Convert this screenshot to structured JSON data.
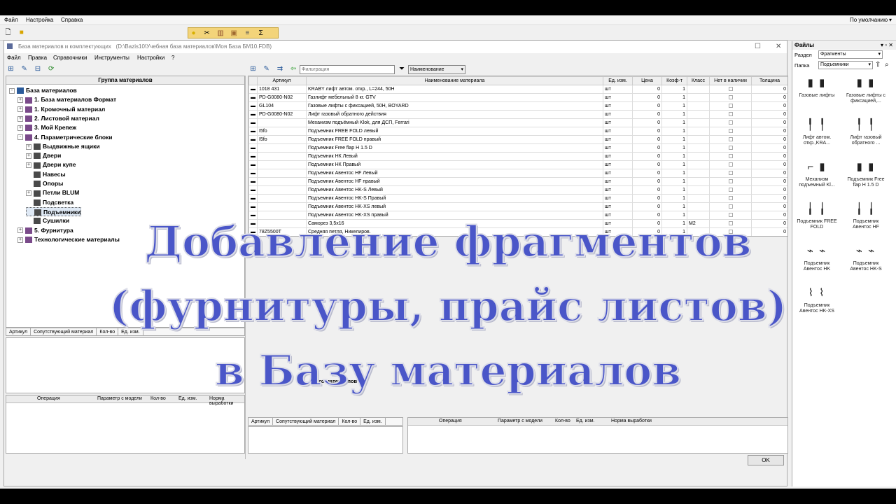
{
  "main_menu": [
    "Файл",
    "Настройка",
    "Справка"
  ],
  "profile": "По умолчанию",
  "child_window": {
    "title": "База материалов и комплектующих",
    "path": "(D:\\Bazis10\\Учебная база материалов\\Моя База БМ10.FDB)",
    "menu": [
      "Файл",
      "Правка",
      "Справочники",
      "Инструменты",
      "Настройки",
      "?"
    ]
  },
  "tree": {
    "header": "Группа материалов",
    "nodes": [
      {
        "label": "База материалов",
        "level": 0,
        "exp": "-"
      },
      {
        "label": "1. База материалов Формат",
        "level": 1,
        "exp": "+"
      },
      {
        "label": "1. Кромочный материал",
        "level": 1,
        "exp": "+"
      },
      {
        "label": "2. Листовой материал",
        "level": 1,
        "exp": "+"
      },
      {
        "label": "3. Мой Крепеж",
        "level": 1,
        "exp": "+"
      },
      {
        "label": "4. Параметрические блоки",
        "level": 1,
        "exp": "-"
      },
      {
        "label": "Выдвижные ящики",
        "level": 2,
        "exp": "+"
      },
      {
        "label": "Двери",
        "level": 2,
        "exp": "+"
      },
      {
        "label": "Двери купе",
        "level": 2,
        "exp": "+"
      },
      {
        "label": "Навесы",
        "level": 2,
        "exp": ""
      },
      {
        "label": "Опоры",
        "level": 2,
        "exp": ""
      },
      {
        "label": "Петли BLUM",
        "level": 2,
        "exp": "+"
      },
      {
        "label": "Подсветка",
        "level": 2,
        "exp": ""
      },
      {
        "label": "Подъемники",
        "level": 2,
        "exp": "",
        "selected": true
      },
      {
        "label": "Сушилки",
        "level": 2,
        "exp": ""
      },
      {
        "label": "5. Фурнитура",
        "level": 1,
        "exp": "+"
      },
      {
        "label": "Технологические материалы",
        "level": 1,
        "exp": "+"
      }
    ]
  },
  "filter_placeholder": "Фильтрация",
  "sort_field": "Наименование",
  "grid": {
    "columns": [
      "Артикул",
      "Наименование материала",
      "Ед. изм.",
      "Цена",
      "Коэф-т",
      "Класс",
      "Нет в наличии",
      "Толщина"
    ],
    "rows": [
      [
        "1018 431",
        "KRABY лифт автом. откр., L=244, 50H",
        "шт",
        "0",
        "1",
        "",
        "",
        "0"
      ],
      [
        "PD-G0080-N02",
        "Газлифт мебельный 8 кг. GTV",
        "шт",
        "0",
        "1",
        "",
        "",
        "0"
      ],
      [
        "GL104",
        "Газовые лифты с фиксацией, 50H, BOYARD",
        "шт",
        "0",
        "1",
        "",
        "",
        "0"
      ],
      [
        "PD-G0080-N02",
        "Лифт газовый обратного действия",
        "шт",
        "0",
        "1",
        "",
        "",
        "0"
      ],
      [
        "",
        "Механизм подъёмный Klok, для ДСП, Ferrari",
        "шт",
        "0",
        "1",
        "",
        "",
        "0"
      ],
      [
        "I5fo",
        "Подъемник FREE FOLD левый",
        "шт",
        "0",
        "1",
        "",
        "",
        "0"
      ],
      [
        "I5fo",
        "Подъемник FREE FOLD правый",
        "шт",
        "0",
        "1",
        "",
        "",
        "0"
      ],
      [
        "",
        "Подъемник Free flap H 1.5 D",
        "шт",
        "0",
        "1",
        "",
        "",
        "0"
      ],
      [
        "",
        "Подъемник НК Левый",
        "шт",
        "0",
        "1",
        "",
        "",
        "0"
      ],
      [
        "",
        "Подъемник НК Правый",
        "шт",
        "0",
        "1",
        "",
        "",
        "0"
      ],
      [
        "",
        "Подъемник Авентос HF Левый",
        "шт",
        "0",
        "1",
        "",
        "",
        "0"
      ],
      [
        "",
        "Подъемник Авентос HF правый",
        "шт",
        "0",
        "1",
        "",
        "",
        "0"
      ],
      [
        "",
        "Подъемник Авентос HK-S Левый",
        "шт",
        "0",
        "1",
        "",
        "",
        "0"
      ],
      [
        "",
        "Подъемник Авентос HK-S Правый",
        "шт",
        "0",
        "1",
        "",
        "",
        "0"
      ],
      [
        "",
        "Подъемник Авентос HK-XS левый",
        "шт",
        "0",
        "1",
        "",
        "",
        "0"
      ],
      [
        "",
        "Подъемник Авентос HK-XS правый",
        "шт",
        "0",
        "1",
        "",
        "",
        "0"
      ],
      [
        "",
        "Саморез 3,5х16",
        "шт",
        "0",
        "1",
        "M2",
        "",
        "0"
      ],
      [
        "78Z5500T",
        "Средняя петля, Никелиров.",
        "шт",
        "0",
        "1",
        "",
        "",
        "0"
      ]
    ]
  },
  "status": "Всего материалов : 18",
  "left_bottom_tabs": [
    "Артикул",
    "Сопутствующий материал",
    "Кол-во",
    "Ед. изм."
  ],
  "left_ops_headers": [
    "Операция",
    "Параметр с модели",
    "Кол-во",
    "Ед. изм.",
    "Норма выработки"
  ],
  "right_bottom_tabs": [
    "Артикул",
    "Сопутствующий материал",
    "Кол-во",
    "Ед. изм."
  ],
  "right_ops_headers": [
    "Операция",
    "Параметр с модели",
    "Кол-во",
    "Ед. изм.",
    "Норма выработки"
  ],
  "ok_label": "OK",
  "files_panel": {
    "title": "Файлы",
    "section_label": "Раздел",
    "section_value": "Фрагменты",
    "folder_label": "Папка",
    "folder_value": "Подъемники",
    "tiles": [
      {
        "caption": "Газовые лифты"
      },
      {
        "caption": "Газовые лифты с фиксацией,..."
      },
      {
        "caption": "Лифт автом. откр.,KRA..."
      },
      {
        "caption": "Лифт газовый обратного ..."
      },
      {
        "caption": "Механизм подъемный Kl..."
      },
      {
        "caption": "Подъемник Free flap H 1.5 D"
      },
      {
        "caption": "Подъемник FREE FOLD"
      },
      {
        "caption": "Подъемник Авентос HF"
      },
      {
        "caption": "Подъемник Авентос HK"
      },
      {
        "caption": "Подъемник Авентос HK-S"
      },
      {
        "caption": "Подъемник Авентос HK-XS"
      }
    ]
  },
  "overlay_lines": [
    "Добавление фрагментов",
    "(фурнитуры, прайс листов)",
    "в Базу материалов"
  ]
}
